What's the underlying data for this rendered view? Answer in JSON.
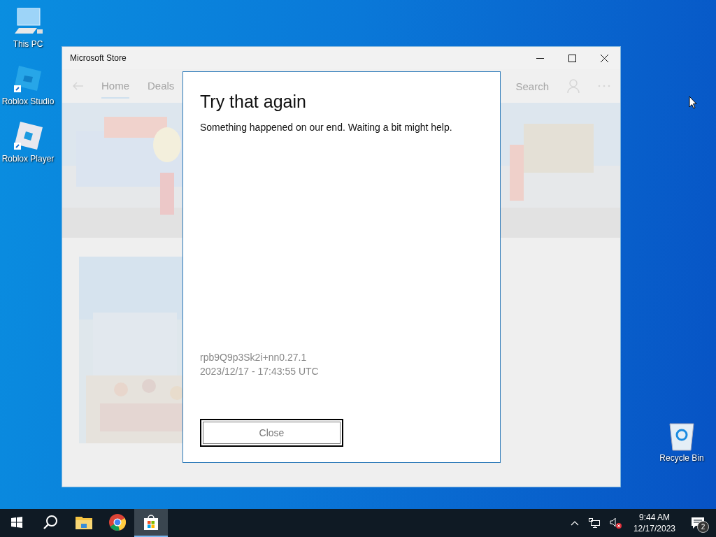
{
  "desktop_icons": [
    {
      "label": "This PC",
      "kind": "pc"
    },
    {
      "label": "Roblox Studio",
      "kind": "studio"
    },
    {
      "label": "Roblox Player",
      "kind": "player"
    }
  ],
  "recycle_bin": {
    "label": "Recycle Bin"
  },
  "window": {
    "title": "Microsoft Store",
    "nav": {
      "tabs": [
        {
          "label": "Home",
          "selected": true
        },
        {
          "label": "Deals",
          "selected": false
        }
      ],
      "search": "Search"
    },
    "dialog": {
      "title": "Try that again",
      "message": "Something happened on our end. Waiting a bit might help.",
      "code": "rpb9Q9p3Sk2i+nn0.27.1",
      "timestamp": "2023/12/17 - 17:43:55 UTC",
      "button": "Close"
    }
  },
  "taskbar": {
    "apps": [
      {
        "kind": "start",
        "selected": false
      },
      {
        "kind": "search",
        "selected": false
      },
      {
        "kind": "folder",
        "selected": false
      },
      {
        "kind": "browser",
        "selected": false
      },
      {
        "kind": "store",
        "selected": true
      }
    ],
    "tray": {
      "muted": true,
      "time": "9:44 AM",
      "date": "12/17/2023",
      "notifications": "2"
    }
  }
}
